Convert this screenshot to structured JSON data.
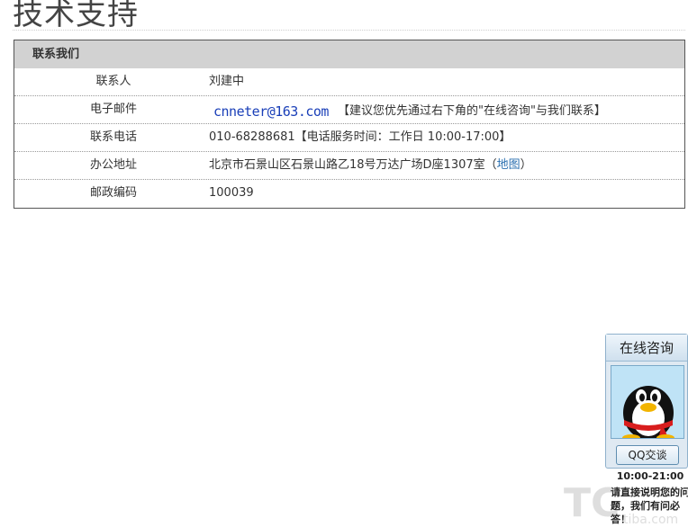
{
  "page": {
    "title": "技术支持"
  },
  "contact": {
    "header": "联系我们",
    "rows": [
      {
        "label": "联系人",
        "value": "刘建中"
      },
      {
        "label": "电子邮件",
        "email": "cnneter@163.com",
        "note": "【建议您优先通过右下角的\"在线咨询\"与我们联系】"
      },
      {
        "label": "联系电话",
        "value": "010-68288681【电话服务时间：工作日 10:00-17:00】"
      },
      {
        "label": "办公地址",
        "value": "北京市石景山区石景山路乙18号万达广场D座1307室（",
        "map_link": "地图",
        "value_suffix": "）"
      },
      {
        "label": "邮政编码",
        "value": "100039"
      }
    ]
  },
  "consult": {
    "title": "在线咨询",
    "button_label": "QQ交谈",
    "hours": "10:00-21:00",
    "note": "请直接说明您的问题，我们有问必答！"
  },
  "watermark": {
    "text": "TC tiba.com"
  },
  "colors": {
    "header_bg": "#d2d2d2",
    "email_link": "#1a3fb8",
    "map_link": "#2a6fb0",
    "widget_bg": "#dfe9f2"
  }
}
